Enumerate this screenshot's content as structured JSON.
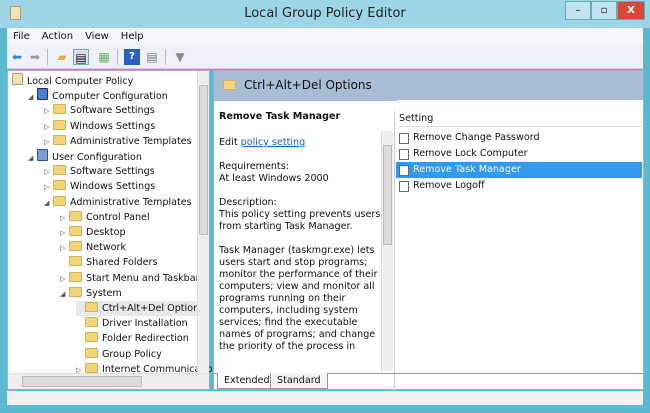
{
  "window": {
    "title": "Local Group Policy Editor",
    "minimize": "–",
    "maximize": "▫",
    "close": "X",
    "close_color": "#d9463a"
  },
  "menu": [
    "File",
    "Action",
    "View",
    "Help"
  ],
  "toolbar": [
    "back-icon",
    "forward-icon",
    "up-folder-icon",
    "show-hide-tree-icon",
    "export-list-icon",
    "help-icon",
    "show-action-pane-icon",
    "filter-icon"
  ],
  "tree": [
    {
      "label": "Local Computer Policy",
      "level": 0,
      "arrow": "",
      "icon": "policy"
    },
    {
      "label": "Computer Configuration",
      "level": 1,
      "arrow": "◢",
      "icon": "computer"
    },
    {
      "label": "Software Settings",
      "level": 2,
      "arrow": "▷",
      "icon": "folder"
    },
    {
      "label": "Windows Settings",
      "level": 2,
      "arrow": "▷",
      "icon": "folder"
    },
    {
      "label": "Administrative Templates",
      "level": 2,
      "arrow": "▷",
      "icon": "folder"
    },
    {
      "label": "User Configuration",
      "level": 1,
      "arrow": "◢",
      "icon": "user"
    },
    {
      "label": "Software Settings",
      "level": 2,
      "arrow": "▷",
      "icon": "folder"
    },
    {
      "label": "Windows Settings",
      "level": 2,
      "arrow": "▷",
      "icon": "folder"
    },
    {
      "label": "Administrative Templates",
      "level": 2,
      "arrow": "◢",
      "icon": "folder"
    },
    {
      "label": "Control Panel",
      "level": 3,
      "arrow": "▷",
      "icon": "folder"
    },
    {
      "label": "Desktop",
      "level": 3,
      "arrow": "▷",
      "icon": "folder"
    },
    {
      "label": "Network",
      "level": 3,
      "arrow": "▷",
      "icon": "folder"
    },
    {
      "label": "Shared Folders",
      "level": 3,
      "arrow": "",
      "icon": "folder"
    },
    {
      "label": "Start Menu and Taskbar",
      "level": 3,
      "arrow": "▷",
      "icon": "folder"
    },
    {
      "label": "System",
      "level": 3,
      "arrow": "◢",
      "icon": "folder"
    },
    {
      "label": "Ctrl+Alt+Del Options",
      "level": 4,
      "arrow": "",
      "icon": "folder",
      "selected": true
    },
    {
      "label": "Driver Installation",
      "level": 4,
      "arrow": "",
      "icon": "folder"
    },
    {
      "label": "Folder Redirection",
      "level": 4,
      "arrow": "",
      "icon": "folder"
    },
    {
      "label": "Group Policy",
      "level": 4,
      "arrow": "",
      "icon": "folder"
    },
    {
      "label": "Internet Communicatio",
      "level": 4,
      "arrow": "▷",
      "icon": "folder"
    }
  ],
  "right": {
    "header": "Ctrl+Alt+Del Options",
    "desc_title": "Remove Task Manager",
    "edit_prefix": "Edit ",
    "edit_link": "policy setting",
    "req_label": "Requirements:",
    "req_value": "At least Windows 2000",
    "desc_label": "Description:",
    "desc_text": "This policy setting prevents users from starting Task Manager.",
    "desc_more": "Task Manager (taskmgr.exe) lets users start and stop programs; monitor the performance of their computers; view and monitor all programs running on their computers, including system services; find the executable names of programs; and change the priority of the process in",
    "column": "Setting",
    "settings": [
      "Remove Change Password",
      "Remove Lock Computer",
      "Remove Task Manager",
      "Remove Logoff"
    ],
    "selected_setting": 2,
    "tabs": [
      "Extended",
      "Standard"
    ]
  }
}
